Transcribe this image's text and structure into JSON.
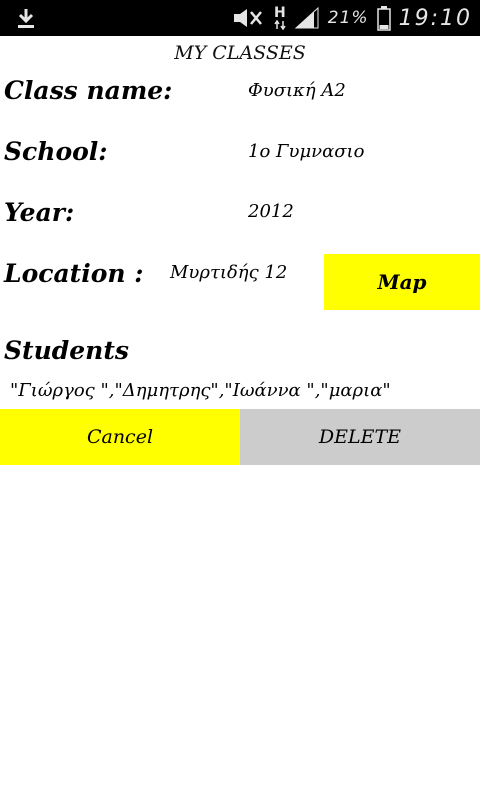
{
  "status_bar": {
    "icons": [
      "download-icon",
      "mute-icon",
      "hspa-data-icon",
      "signal-icon",
      "battery-icon"
    ],
    "network_label": "H",
    "battery_percent": "21%",
    "time": "19:10"
  },
  "page": {
    "title": "MY CLASSES"
  },
  "fields": {
    "class_name": {
      "label": "Class name:",
      "value": "Φυσική Α2"
    },
    "school": {
      "label": "School:",
      "value": "1ο Γυμνασιο"
    },
    "year": {
      "label": "Year:",
      "value": "2012"
    },
    "location": {
      "label": "Location :",
      "value": "Μυρτιδής 12"
    }
  },
  "map_button": {
    "label": "Map"
  },
  "students": {
    "heading": "Students",
    "list_text": "\"Γιώργος \",\"Δημητρης\",\"Ιωάννα \",\"μαρια\""
  },
  "actions": {
    "cancel_label": "Cancel",
    "delete_label": "DELETE"
  },
  "colors": {
    "status_bar": "#000000",
    "primary_button": "#ffff00",
    "secondary_button": "#cccccc",
    "background": "#ffffff"
  }
}
